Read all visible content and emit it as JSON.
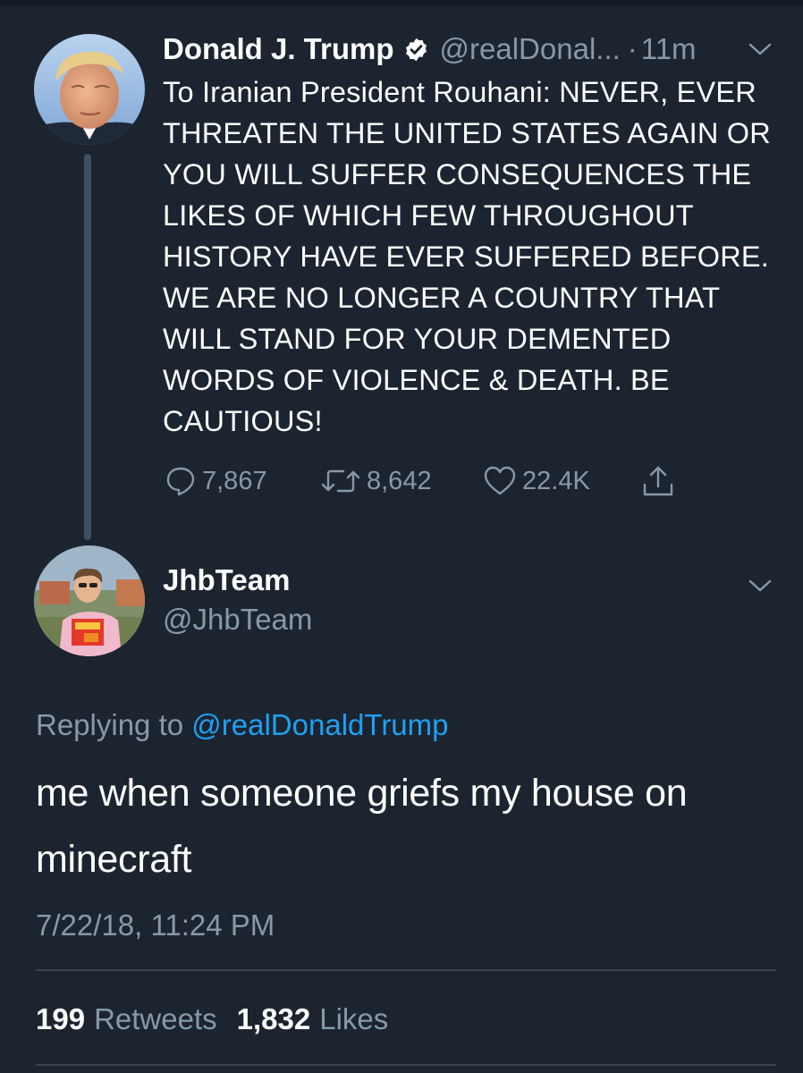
{
  "original_tweet": {
    "display_name": "Donald J. Trump",
    "handle": "@realDonal...",
    "separator": "·",
    "time_ago": "11m",
    "verified": true,
    "text": "To Iranian President Rouhani: NEVER, EVER THREATEN THE UNITED STATES AGAIN OR YOU WILL SUFFER CONSEQUENCES THE LIKES OF WHICH FEW THROUGHOUT HISTORY HAVE EVER SUFFERED BEFORE. WE ARE NO LONGER A COUNTRY THAT WILL STAND FOR YOUR DEMENTED WORDS OF VIOLENCE & DEATH. BE CAUTIOUS!",
    "replies": "7,867",
    "retweets": "8,642",
    "likes": "22.4K"
  },
  "reply_tweet": {
    "display_name": "JhbTeam",
    "handle": "@JhbTeam",
    "replying_label": "Replying to",
    "replying_handle": "@realDonaldTrump",
    "text": "me when someone griefs my house on minecraft",
    "timestamp": "7/22/18, 11:24 PM",
    "retweet_count": "199",
    "retweet_label": "Retweets",
    "like_count": "1,832",
    "like_label": "Likes"
  },
  "colors": {
    "background": "#1c2430",
    "text_primary": "#ffffff",
    "text_secondary": "#8899a6",
    "link": "#1da1f2",
    "thread_line": "#3e5062",
    "divider": "#38444d"
  },
  "icons": [
    "verified-badge-icon",
    "chevron-down-icon",
    "reply-icon",
    "retweet-icon",
    "like-icon",
    "share-icon"
  ]
}
